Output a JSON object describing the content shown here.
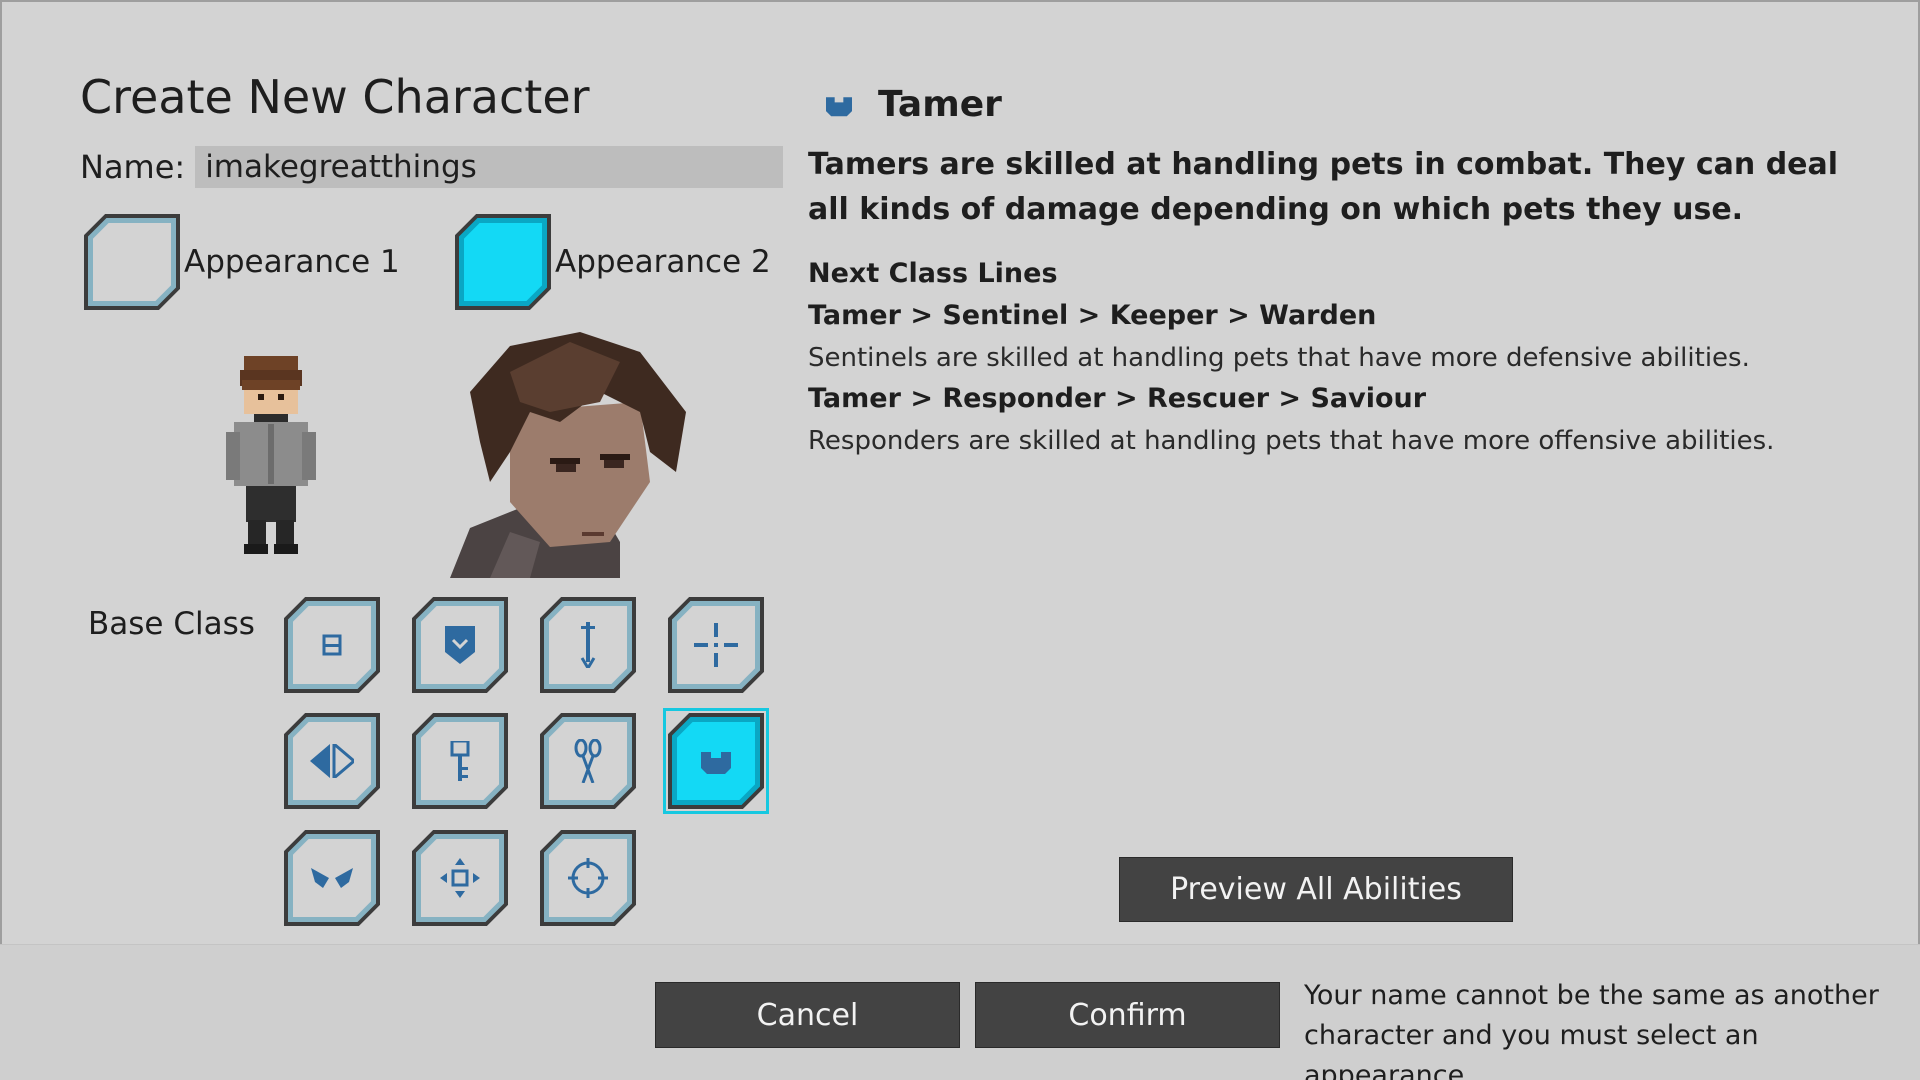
{
  "title": "Create New Character",
  "name_field": {
    "label": "Name:",
    "value": "imakegreatthings"
  },
  "appearances": [
    {
      "label": "Appearance 1",
      "selected": false
    },
    {
      "label": "Appearance 2",
      "selected": true
    }
  ],
  "base_class": {
    "label": "Base Class",
    "icons": [
      "bars-icon",
      "shield-icon",
      "sword-icon",
      "crosshair-icon",
      "split-icon",
      "key-icon",
      "scissors-icon",
      "pet-bowl-icon",
      "wings-icon",
      "move-icon",
      "target-icon"
    ],
    "selected_index": 7
  },
  "class_info": {
    "icon": "pet-bowl-icon",
    "name": "Tamer",
    "description": "Tamers are skilled at handling pets in combat. They can deal all kinds of damage depending on which pets they use.",
    "next_lines_label": "Next Class Lines",
    "lines": [
      {
        "path": "Tamer > Sentinel > Keeper > Warden",
        "desc": "Sentinels are skilled at handling pets that have more defensive abilities."
      },
      {
        "path": "Tamer > Responder > Rescuer > Saviour",
        "desc": "Responders are skilled at handling pets that have more offensive abilities."
      }
    ]
  },
  "buttons": {
    "preview": "Preview All Abilities",
    "cancel": "Cancel",
    "confirm": "Confirm"
  },
  "note": "Your name cannot be the same as another character and you must select an appearance.",
  "colors": {
    "accent": "#13d9f5",
    "button": "#434343",
    "background": "#d3d3d3",
    "icon": "#2e6aa0"
  }
}
